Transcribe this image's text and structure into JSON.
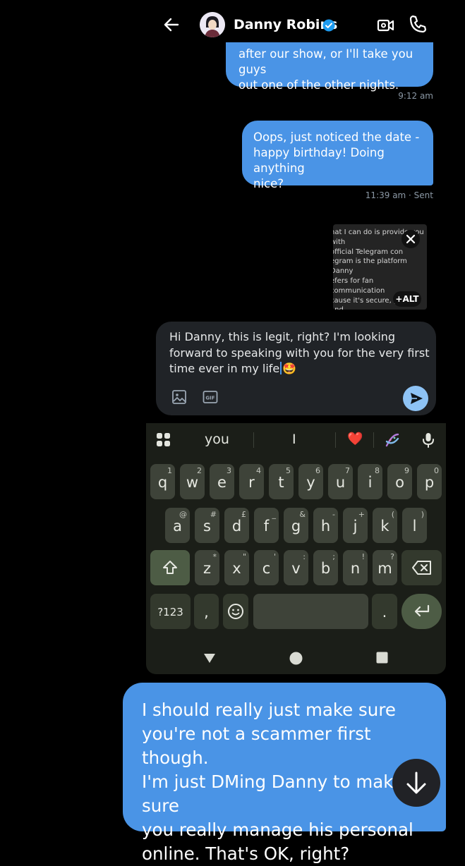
{
  "header": {
    "name": "Danny Robins"
  },
  "messages": [
    {
      "text": "after our show, or I'll take you guys\nout one of the other nights.",
      "meta": "9:12 am"
    },
    {
      "text": "Oops, just noticed the date -\nhappy birthday! Doing anything\nnice?",
      "meta": "11:39 am · Sent"
    }
  ],
  "attachment": {
    "snippet": "nat I can do is provide you with\n official Telegram con\negram is the platform Danny\nefers for fan communication\ncause it's secure, private, and\nps him keep things organized\nay from crowded social med\noxes.",
    "alt_label": "+ALT"
  },
  "composer": {
    "text": "Hi Danny, this is legit, right? I'm looking forward to speaking with you for the very first time ever in my life",
    "emoji": "🤩"
  },
  "keyboard": {
    "suggestions": [
      "you",
      "I",
      "❤️"
    ],
    "row1": [
      {
        "k": "q",
        "s": "1"
      },
      {
        "k": "w",
        "s": "2"
      },
      {
        "k": "e",
        "s": "3"
      },
      {
        "k": "r",
        "s": "4"
      },
      {
        "k": "t",
        "s": "5"
      },
      {
        "k": "y",
        "s": "6"
      },
      {
        "k": "u",
        "s": "7"
      },
      {
        "k": "i",
        "s": "8"
      },
      {
        "k": "o",
        "s": "9"
      },
      {
        "k": "p",
        "s": "0"
      }
    ],
    "row2": [
      {
        "k": "a",
        "s": "@"
      },
      {
        "k": "s",
        "s": "#"
      },
      {
        "k": "d",
        "s": "£"
      },
      {
        "k": "f",
        "s": "_"
      },
      {
        "k": "g",
        "s": "&"
      },
      {
        "k": "h",
        "s": "-"
      },
      {
        "k": "j",
        "s": "+"
      },
      {
        "k": "k",
        "s": "("
      },
      {
        "k": "l",
        "s": ")"
      }
    ],
    "row3": [
      {
        "k": "z",
        "s": "*"
      },
      {
        "k": "x",
        "s": "\""
      },
      {
        "k": "c",
        "s": "'"
      },
      {
        "k": "v",
        "s": ":"
      },
      {
        "k": "b",
        "s": ";"
      },
      {
        "k": "n",
        "s": "!"
      },
      {
        "k": "m",
        "s": "?"
      }
    ],
    "symbols_key": "?123",
    "comma": ",",
    "period": "."
  },
  "draft_message": {
    "text": "I should really just make sure\nyou're not a scammer first though.\nI'm just DMing Danny to make sure\nyou really manage his personal\nonline. That's OK, right?"
  },
  "colors": {
    "bubble": "#4a94e6",
    "verified": "#1d9bf0",
    "keyboard_bg": "#1b1e18",
    "key": "#3e4339",
    "send": "#8ec3f5"
  },
  "icons": {
    "back": "arrow-left-icon",
    "verified": "verified-badge-icon",
    "video": "video-call-icon",
    "phone": "phone-icon",
    "close": "close-icon",
    "media": "image-icon",
    "gif": "gif-icon",
    "send": "send-icon",
    "scroll": "arrow-down-icon"
  }
}
